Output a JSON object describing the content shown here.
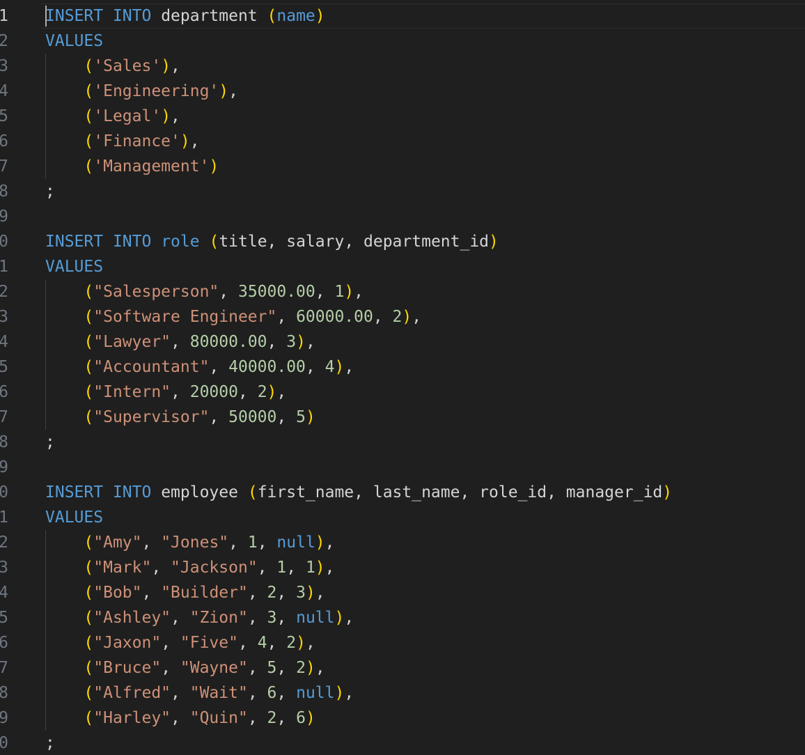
{
  "editor": {
    "language": "sql",
    "active_line": 1,
    "colors": {
      "background": "#1f1f1f",
      "keyword": "#569cd6",
      "string": "#ce9178",
      "number": "#b5cea8",
      "bracket": "#ffd700",
      "identifier": "#d4d4d4",
      "line_number": "#6e7681"
    },
    "lines": [
      {
        "n": "1",
        "tokens": [
          [
            "INSERT",
            "kw"
          ],
          [
            " ",
            ""
          ],
          [
            "INTO",
            "kw"
          ],
          [
            " department ",
            "id"
          ],
          [
            "(",
            "br"
          ],
          [
            "name",
            "kw"
          ],
          [
            ")",
            "br"
          ]
        ]
      },
      {
        "n": "2",
        "tokens": [
          [
            "VALUES",
            "kw"
          ]
        ]
      },
      {
        "n": "3",
        "tokens": [
          [
            "    ",
            ""
          ],
          [
            "(",
            "br"
          ],
          [
            "'Sales'",
            "str"
          ],
          [
            ")",
            "br"
          ],
          [
            ",",
            "id"
          ]
        ]
      },
      {
        "n": "4",
        "tokens": [
          [
            "    ",
            ""
          ],
          [
            "(",
            "br"
          ],
          [
            "'Engineering'",
            "str"
          ],
          [
            ")",
            "br"
          ],
          [
            ",",
            "id"
          ]
        ]
      },
      {
        "n": "5",
        "tokens": [
          [
            "    ",
            ""
          ],
          [
            "(",
            "br"
          ],
          [
            "'Legal'",
            "str"
          ],
          [
            ")",
            "br"
          ],
          [
            ",",
            "id"
          ]
        ]
      },
      {
        "n": "6",
        "tokens": [
          [
            "    ",
            ""
          ],
          [
            "(",
            "br"
          ],
          [
            "'Finance'",
            "str"
          ],
          [
            ")",
            "br"
          ],
          [
            ",",
            "id"
          ]
        ]
      },
      {
        "n": "7",
        "tokens": [
          [
            "    ",
            ""
          ],
          [
            "(",
            "br"
          ],
          [
            "'Management'",
            "str"
          ],
          [
            ")",
            "br"
          ]
        ]
      },
      {
        "n": "8",
        "tokens": [
          [
            ";",
            "id"
          ]
        ]
      },
      {
        "n": "9",
        "tokens": []
      },
      {
        "n": "0",
        "tokens": [
          [
            "INSERT",
            "kw"
          ],
          [
            " ",
            ""
          ],
          [
            "INTO",
            "kw"
          ],
          [
            " ",
            ""
          ],
          [
            "role",
            "kw"
          ],
          [
            " ",
            ""
          ],
          [
            "(",
            "br"
          ],
          [
            "title, salary, department_id",
            "id"
          ],
          [
            ")",
            "br"
          ]
        ]
      },
      {
        "n": "1",
        "tokens": [
          [
            "VALUES",
            "kw"
          ]
        ]
      },
      {
        "n": "2",
        "tokens": [
          [
            "    ",
            ""
          ],
          [
            "(",
            "br"
          ],
          [
            "\"Salesperson\"",
            "str"
          ],
          [
            ", ",
            "id"
          ],
          [
            "35000.00",
            "num"
          ],
          [
            ", ",
            "id"
          ],
          [
            "1",
            "num"
          ],
          [
            ")",
            "br"
          ],
          [
            ",",
            "id"
          ]
        ]
      },
      {
        "n": "3",
        "tokens": [
          [
            "    ",
            ""
          ],
          [
            "(",
            "br"
          ],
          [
            "\"Software Engineer\"",
            "str"
          ],
          [
            ", ",
            "id"
          ],
          [
            "60000.00",
            "num"
          ],
          [
            ", ",
            "id"
          ],
          [
            "2",
            "num"
          ],
          [
            ")",
            "br"
          ],
          [
            ",",
            "id"
          ]
        ]
      },
      {
        "n": "4",
        "tokens": [
          [
            "    ",
            ""
          ],
          [
            "(",
            "br"
          ],
          [
            "\"Lawyer\"",
            "str"
          ],
          [
            ", ",
            "id"
          ],
          [
            "80000.00",
            "num"
          ],
          [
            ", ",
            "id"
          ],
          [
            "3",
            "num"
          ],
          [
            ")",
            "br"
          ],
          [
            ",",
            "id"
          ]
        ]
      },
      {
        "n": "5",
        "tokens": [
          [
            "    ",
            ""
          ],
          [
            "(",
            "br"
          ],
          [
            "\"Accountant\"",
            "str"
          ],
          [
            ", ",
            "id"
          ],
          [
            "40000.00",
            "num"
          ],
          [
            ", ",
            "id"
          ],
          [
            "4",
            "num"
          ],
          [
            ")",
            "br"
          ],
          [
            ",",
            "id"
          ]
        ]
      },
      {
        "n": "6",
        "tokens": [
          [
            "    ",
            ""
          ],
          [
            "(",
            "br"
          ],
          [
            "\"Intern\"",
            "str"
          ],
          [
            ", ",
            "id"
          ],
          [
            "20000",
            "num"
          ],
          [
            ", ",
            "id"
          ],
          [
            "2",
            "num"
          ],
          [
            ")",
            "br"
          ],
          [
            ",",
            "id"
          ]
        ]
      },
      {
        "n": "7",
        "tokens": [
          [
            "    ",
            ""
          ],
          [
            "(",
            "br"
          ],
          [
            "\"Supervisor\"",
            "str"
          ],
          [
            ", ",
            "id"
          ],
          [
            "50000",
            "num"
          ],
          [
            ", ",
            "id"
          ],
          [
            "5",
            "num"
          ],
          [
            ")",
            "br"
          ]
        ]
      },
      {
        "n": "8",
        "tokens": [
          [
            ";",
            "id"
          ]
        ]
      },
      {
        "n": "9",
        "tokens": []
      },
      {
        "n": "0",
        "tokens": [
          [
            "INSERT",
            "kw"
          ],
          [
            " ",
            ""
          ],
          [
            "INTO",
            "kw"
          ],
          [
            " employee ",
            "id"
          ],
          [
            "(",
            "br"
          ],
          [
            "first_name, last_name, role_id, manager_id",
            "id"
          ],
          [
            ")",
            "br"
          ]
        ]
      },
      {
        "n": "1",
        "tokens": [
          [
            "VALUES",
            "kw"
          ]
        ]
      },
      {
        "n": "2",
        "tokens": [
          [
            "    ",
            ""
          ],
          [
            "(",
            "br"
          ],
          [
            "\"Amy\"",
            "str"
          ],
          [
            ", ",
            "id"
          ],
          [
            "\"Jones\"",
            "str"
          ],
          [
            ", ",
            "id"
          ],
          [
            "1",
            "num"
          ],
          [
            ", ",
            "id"
          ],
          [
            "null",
            "kw"
          ],
          [
            ")",
            "br"
          ],
          [
            ",",
            "id"
          ]
        ]
      },
      {
        "n": "3",
        "tokens": [
          [
            "    ",
            ""
          ],
          [
            "(",
            "br"
          ],
          [
            "\"Mark\"",
            "str"
          ],
          [
            ", ",
            "id"
          ],
          [
            "\"Jackson\"",
            "str"
          ],
          [
            ", ",
            "id"
          ],
          [
            "1",
            "num"
          ],
          [
            ", ",
            "id"
          ],
          [
            "1",
            "num"
          ],
          [
            ")",
            "br"
          ],
          [
            ",",
            "id"
          ]
        ]
      },
      {
        "n": "4",
        "tokens": [
          [
            "    ",
            ""
          ],
          [
            "(",
            "br"
          ],
          [
            "\"Bob\"",
            "str"
          ],
          [
            ", ",
            "id"
          ],
          [
            "\"Builder\"",
            "str"
          ],
          [
            ", ",
            "id"
          ],
          [
            "2",
            "num"
          ],
          [
            ", ",
            "id"
          ],
          [
            "3",
            "num"
          ],
          [
            ")",
            "br"
          ],
          [
            ",",
            "id"
          ]
        ]
      },
      {
        "n": "5",
        "tokens": [
          [
            "    ",
            ""
          ],
          [
            "(",
            "br"
          ],
          [
            "\"Ashley\"",
            "str"
          ],
          [
            ", ",
            "id"
          ],
          [
            "\"Zion\"",
            "str"
          ],
          [
            ", ",
            "id"
          ],
          [
            "3",
            "num"
          ],
          [
            ", ",
            "id"
          ],
          [
            "null",
            "kw"
          ],
          [
            ")",
            "br"
          ],
          [
            ",",
            "id"
          ]
        ]
      },
      {
        "n": "6",
        "tokens": [
          [
            "    ",
            ""
          ],
          [
            "(",
            "br"
          ],
          [
            "\"Jaxon\"",
            "str"
          ],
          [
            ", ",
            "id"
          ],
          [
            "\"Five\"",
            "str"
          ],
          [
            ", ",
            "id"
          ],
          [
            "4",
            "num"
          ],
          [
            ", ",
            "id"
          ],
          [
            "2",
            "num"
          ],
          [
            ")",
            "br"
          ],
          [
            ",",
            "id"
          ]
        ]
      },
      {
        "n": "7",
        "tokens": [
          [
            "    ",
            ""
          ],
          [
            "(",
            "br"
          ],
          [
            "\"Bruce\"",
            "str"
          ],
          [
            ", ",
            "id"
          ],
          [
            "\"Wayne\"",
            "str"
          ],
          [
            ", ",
            "id"
          ],
          [
            "5",
            "num"
          ],
          [
            ", ",
            "id"
          ],
          [
            "2",
            "num"
          ],
          [
            ")",
            "br"
          ],
          [
            ",",
            "id"
          ]
        ]
      },
      {
        "n": "8",
        "tokens": [
          [
            "    ",
            ""
          ],
          [
            "(",
            "br"
          ],
          [
            "\"Alfred\"",
            "str"
          ],
          [
            ", ",
            "id"
          ],
          [
            "\"Wait\"",
            "str"
          ],
          [
            ", ",
            "id"
          ],
          [
            "6",
            "num"
          ],
          [
            ", ",
            "id"
          ],
          [
            "null",
            "kw"
          ],
          [
            ")",
            "br"
          ],
          [
            ",",
            "id"
          ]
        ]
      },
      {
        "n": "9",
        "tokens": [
          [
            "    ",
            ""
          ],
          [
            "(",
            "br"
          ],
          [
            "\"Harley\"",
            "str"
          ],
          [
            ", ",
            "id"
          ],
          [
            "\"Quin\"",
            "str"
          ],
          [
            ", ",
            "id"
          ],
          [
            "2",
            "num"
          ],
          [
            ", ",
            "id"
          ],
          [
            "6",
            "num"
          ],
          [
            ")",
            "br"
          ]
        ]
      },
      {
        "n": "0",
        "tokens": [
          [
            ";",
            "id"
          ]
        ]
      }
    ]
  }
}
